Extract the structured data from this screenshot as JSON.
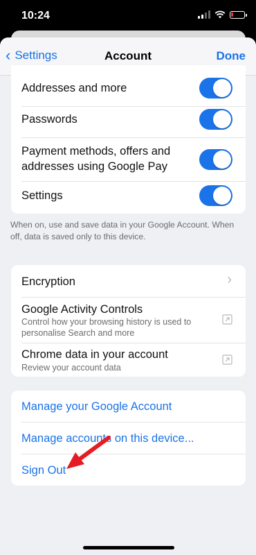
{
  "status": {
    "time": "10:24"
  },
  "nav": {
    "back_label": "Settings",
    "title": "Account",
    "done_label": "Done"
  },
  "sync_card": {
    "rows": [
      {
        "label": "Addresses and more",
        "on": true
      },
      {
        "label": "Passwords",
        "on": true
      },
      {
        "label": "Payment methods, offers and addresses using Google Pay",
        "on": true
      },
      {
        "label": "Settings",
        "on": true
      }
    ],
    "footer": "When on, use and save data in your Google Account. When off, data is saved only to this device."
  },
  "data_card": {
    "encryption": "Encryption",
    "activity_title": "Google Activity Controls",
    "activity_sub": "Control how your browsing history is used to personalise Search and more",
    "chrome_title": "Chrome data in your account",
    "chrome_sub": "Review your account data"
  },
  "account_card": {
    "manage_google": "Manage your Google Account",
    "manage_device": "Manage accounts on this device...",
    "sign_out": "Sign Out"
  },
  "colors": {
    "accent": "#1a73e8",
    "arrow": "#e51c23"
  },
  "icons": [
    "chevron-left-icon",
    "chevron-right-icon",
    "external-link-icon",
    "wifi-icon",
    "battery-icon",
    "signal-icon"
  ]
}
